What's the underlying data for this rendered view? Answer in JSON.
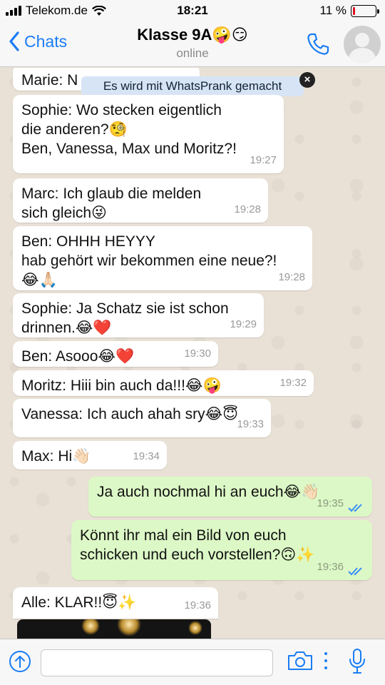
{
  "status_bar": {
    "carrier": "Telekom.de",
    "time": "18:21",
    "battery_percent": "11 %",
    "battery_level": 0.11
  },
  "header": {
    "back_label": "Chats",
    "title": "Klasse 9A🤪😏",
    "subtitle": "online"
  },
  "prank_banner": {
    "text": "Es wird mit WhatsPrank gemacht",
    "close_label": "×"
  },
  "messages": [
    {
      "text": "Marie: N",
      "time": ""
    },
    {
      "text": "Sophie: Wo stecken eigentlich\ndie anderen?🧐\nBen, Vanessa, Max und Moritz?!",
      "time": "19:27"
    },
    {
      "text": "Marc: Ich glaub die melden\nsich gleich😜",
      "time": "19:28"
    },
    {
      "text": "Ben: OHHH HEYYY\nhab gehört wir bekommen eine neue?!\n😂🙏🏻",
      "time": "19:28"
    },
    {
      "text": "Sophie: Ja Schatz sie ist schon\ndrinnen.😂❤️",
      "time": "19:29"
    },
    {
      "text": "Ben: Asooo😂❤️",
      "time": "19:30"
    },
    {
      "text": "Moritz: Hiii bin auch da!!!😂🤪",
      "time": "19:32"
    },
    {
      "text": "Vanessa: Ich auch ahah sry😂😇",
      "time": "19:33"
    },
    {
      "text": "Max: Hi👋🏻",
      "time": "19:34"
    },
    {
      "text": "Ja auch nochmal hi an euch😂👋🏻",
      "time": "19:35"
    },
    {
      "text": "Könnt ihr mal ein Bild von euch\nschicken und euch vorstellen?🙃✨",
      "time": "19:36"
    },
    {
      "text": "Alle: KLAR!!😇✨",
      "time": "19:36"
    }
  ],
  "input": {
    "placeholder": "",
    "value": ""
  },
  "colors": {
    "accent": "#1a7cf4",
    "incoming_bubble": "#ffffff",
    "outgoing_bubble": "#dcf8c6",
    "chat_background": "#e9e1d6",
    "battery_low": "#dd1122"
  },
  "icons": {
    "back": "chevron-left-icon",
    "call": "phone-icon",
    "avatar": "user-silhouette-icon",
    "upload": "arrow-up-circle-icon",
    "camera": "camera-icon",
    "more": "vertical-dots-icon",
    "microphone": "microphone-icon",
    "read": "double-check-icon"
  }
}
